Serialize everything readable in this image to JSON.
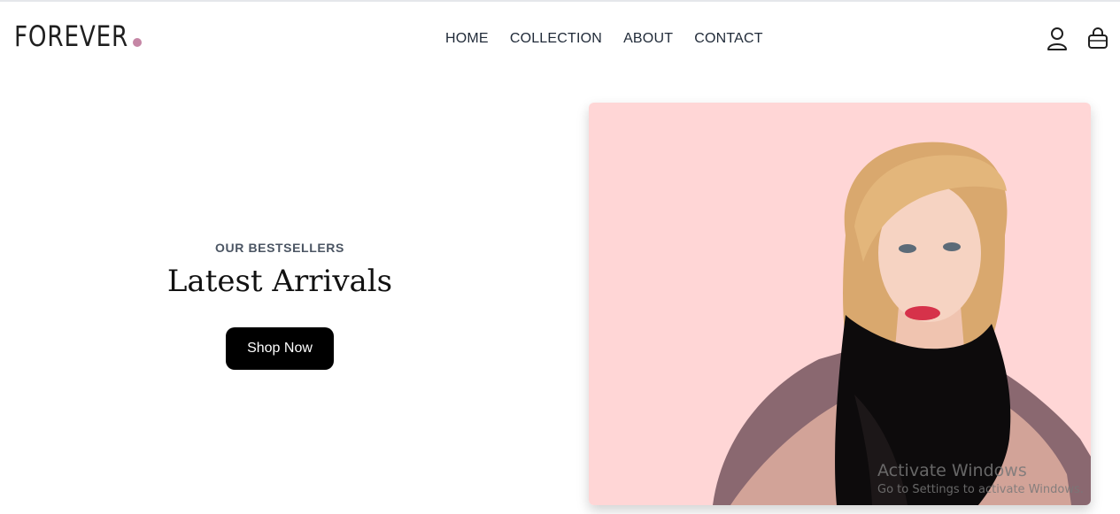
{
  "brand": {
    "logo_text": "FOREVER",
    "accent_color": "#c586a5"
  },
  "nav": {
    "items": [
      "HOME",
      "COLLECTION",
      "ABOUT",
      "CONTACT"
    ]
  },
  "header_icons": [
    "profile-icon",
    "shopping-bag-icon"
  ],
  "hero": {
    "kicker": "OUR BESTSELLERS",
    "title": "Latest Arrivals",
    "button_label": "Shop Now",
    "button_color": "#000000",
    "image_background": "#ffd6d6"
  },
  "system_overlay": {
    "title": "Activate Windows",
    "subtitle": "Go to Settings to activate Windows."
  }
}
